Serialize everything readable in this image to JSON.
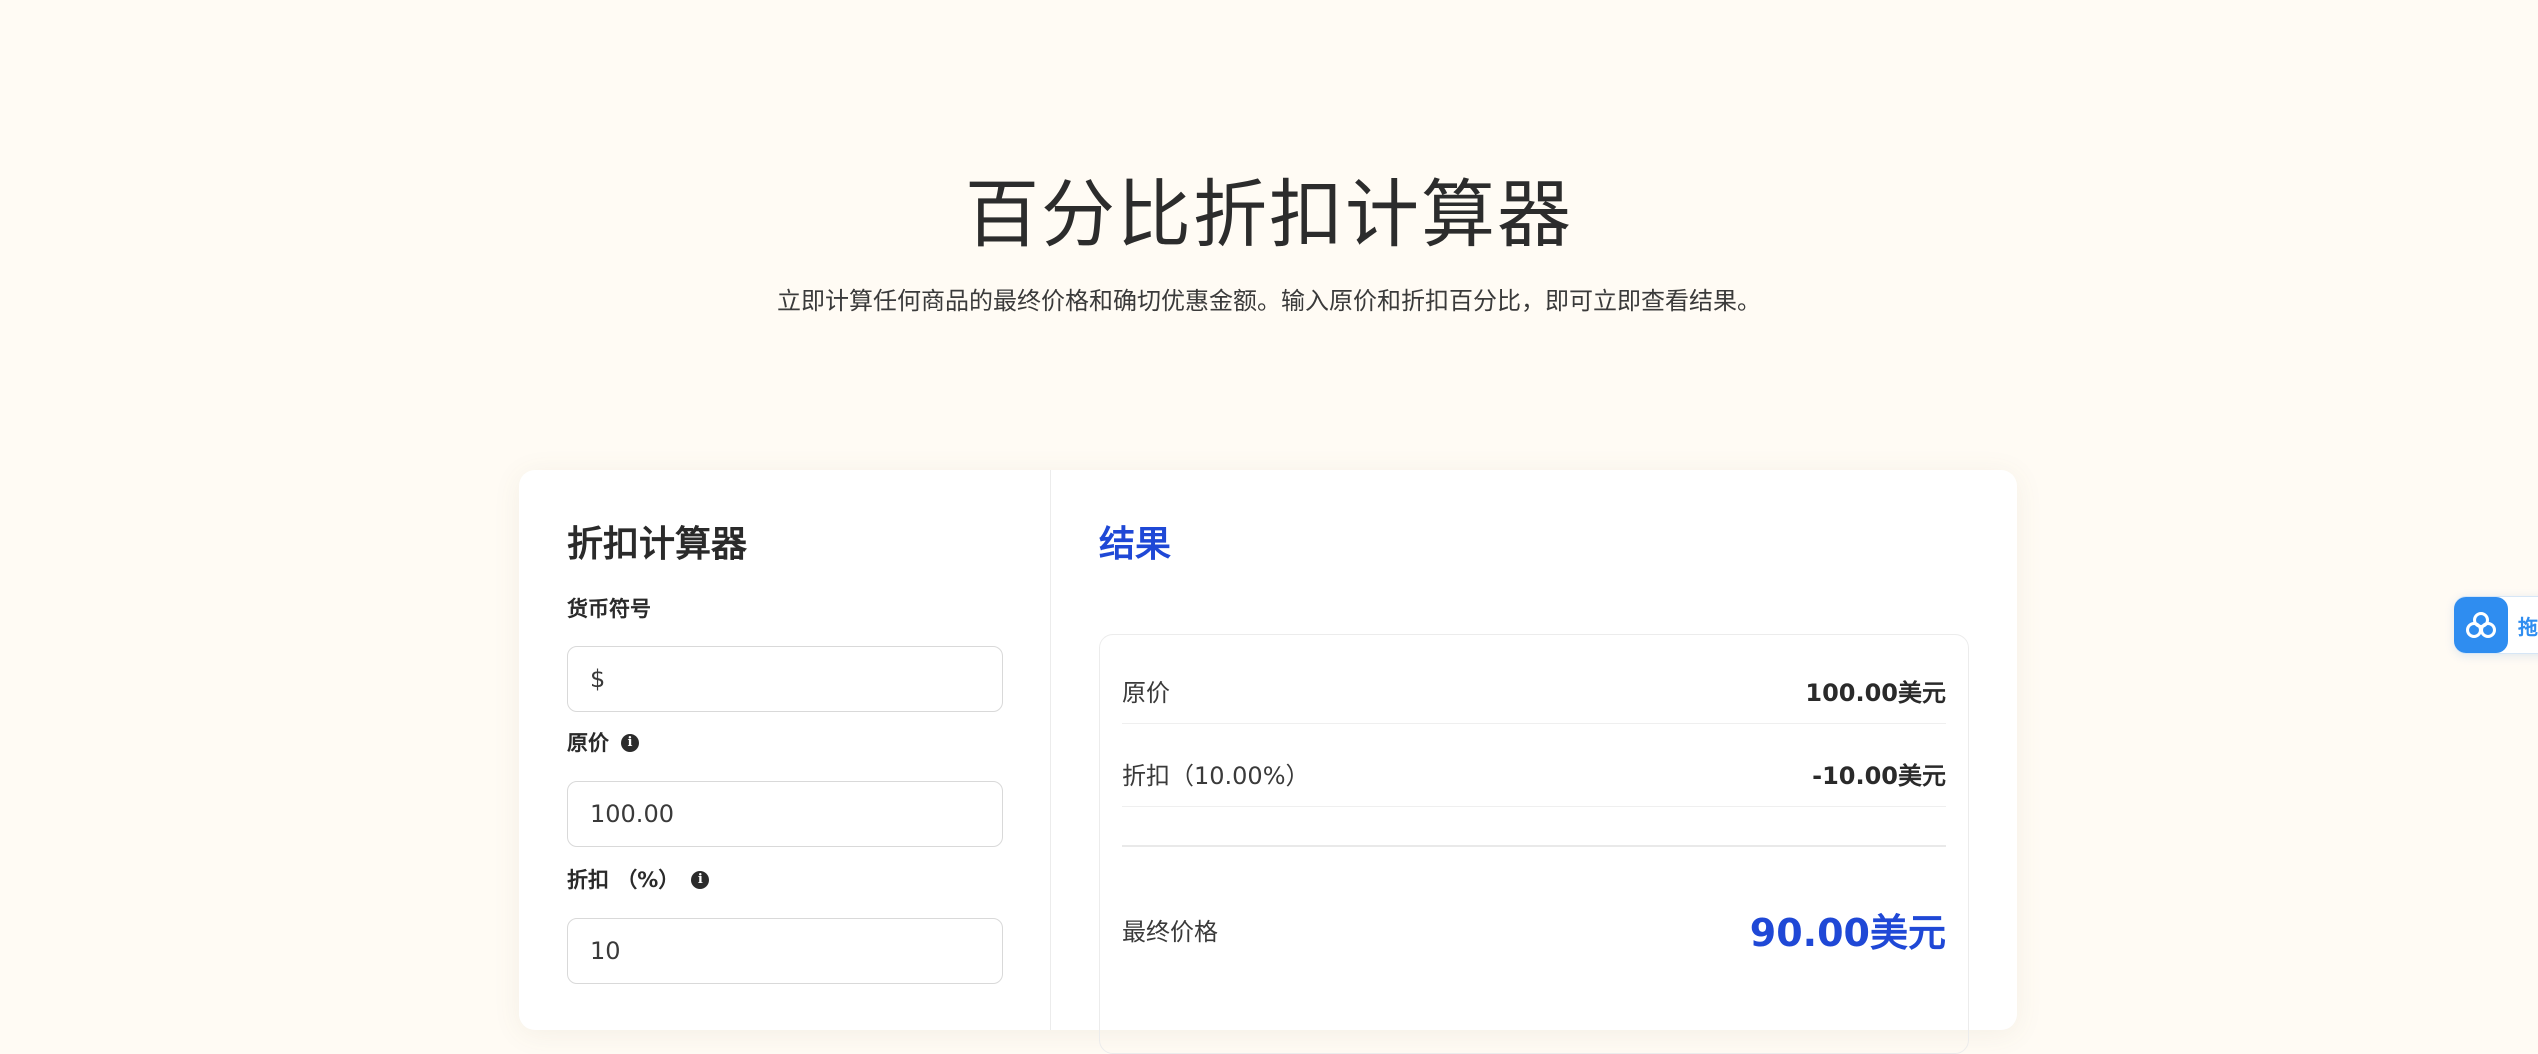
{
  "hero": {
    "title": "百分比折扣计算器",
    "subtitle": "立即计算任何商品的最终价格和确切优惠金额。输入原价和折扣百分比，即可立即查看结果。"
  },
  "calculator": {
    "title": "折扣计算器",
    "currency_label": "货币符号",
    "currency_value": "$",
    "price_label": "原价",
    "price_value": "100.00",
    "discount_label": "折扣 （%）",
    "discount_value": "10",
    "info_icon": "info-icon"
  },
  "results": {
    "title": "结果",
    "original_label": "原价",
    "original_value": "100.00美元",
    "discount_label": "折扣（10.00%）",
    "discount_value": "-10.00美元",
    "final_label": "最终价格",
    "final_value": "90.00美元"
  },
  "widget": {
    "text": "拖",
    "icon": "cloud-link-icon"
  },
  "colors": {
    "background": "#fffbf4",
    "accent": "#1f48d6",
    "widget": "#2f8df0"
  }
}
